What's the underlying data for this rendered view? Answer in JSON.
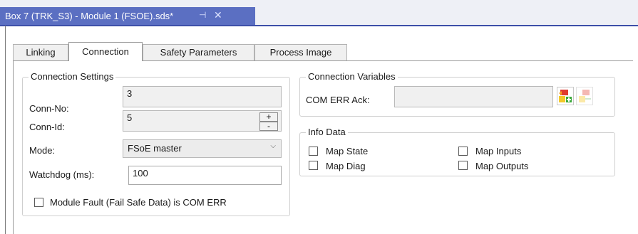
{
  "document_tab": {
    "title": "Box 7 (TRK_S3) - Module 1 (FSOE).sds*",
    "pin_glyph": "⊣",
    "close_glyph": "✕"
  },
  "tabs": [
    {
      "label": "Linking"
    },
    {
      "label": "Connection"
    },
    {
      "label": "Safety Parameters"
    },
    {
      "label": "Process Image"
    }
  ],
  "connection_settings": {
    "legend": "Connection Settings",
    "conn_no_label": "Conn-No:",
    "conn_no_value": "3",
    "conn_id_label": "Conn-Id:",
    "conn_id_value": "5",
    "spin_up": "+",
    "spin_down": "-",
    "mode_label": "Mode:",
    "mode_value": "FSoE master",
    "mode_chevron": "⌵",
    "watchdog_label": "Watchdog (ms):",
    "watchdog_value": "100",
    "module_fault_label": "Module Fault (Fail Safe Data) is COM ERR"
  },
  "connection_variables": {
    "legend": "Connection Variables",
    "com_err_ack_label": "COM ERR Ack:",
    "com_err_ack_value": ""
  },
  "info_data": {
    "legend": "Info Data",
    "map_state": "Map State",
    "map_diag": "Map Diag",
    "map_inputs": "Map Inputs",
    "map_outputs": "Map Outputs"
  },
  "colors": {
    "active_doc_tab": "#5b6fc2",
    "tab_strip_rule": "#3d4fa8",
    "link_icon_red": "#e03a2f",
    "link_icon_yellow": "#f3c92a",
    "link_icon_green": "#3aa83a"
  }
}
